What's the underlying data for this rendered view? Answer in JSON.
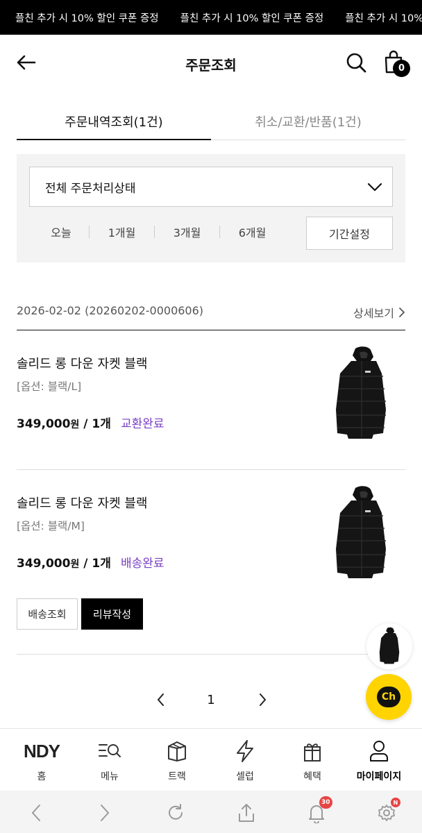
{
  "banner": {
    "messages": [
      "플친 추가 시 10% 할인 쿠폰 증정",
      "플친 추가 시 10% 할인 쿠폰 증정",
      "플친 추가 시 10% 할인 쿠폰 증정"
    ]
  },
  "header": {
    "title": "주문조회",
    "cart_count": "0"
  },
  "tabs": [
    {
      "label": "주문내역조회(1건)",
      "active": true
    },
    {
      "label": "취소/교환/반품(1건)",
      "active": false
    }
  ],
  "filter": {
    "status_select": "전체 주문처리상태",
    "periods": [
      "오늘",
      "1개월",
      "3개월",
      "6개월"
    ],
    "custom_period": "기간설정"
  },
  "order": {
    "date_number": "2026-02-02 (20260202-0000606)",
    "detail_label": "상세보기",
    "items": [
      {
        "name": "솔리드 롱 다운 자켓 블랙",
        "option": "[옵션: 블랙/L]",
        "price": "349,000",
        "currency": "원",
        "qty": " / 1개",
        "status": "교환완료"
      },
      {
        "name": "솔리드 롱 다운 자켓 블랙",
        "option": "[옵션: 블랙/M]",
        "price": "349,000",
        "currency": "원",
        "qty": " / 1개",
        "status": "배송완료"
      }
    ],
    "buttons": {
      "track": "배송조회",
      "review": "리뷰작성"
    }
  },
  "pagination": {
    "current": "1"
  },
  "chat": {
    "label": "Ch"
  },
  "bottom_nav": [
    {
      "label": "홈",
      "icon": "ndy-logo",
      "logo_text": "NDY"
    },
    {
      "label": "메뉴",
      "icon": "menu-search-icon"
    },
    {
      "label": "트랙",
      "icon": "box-icon"
    },
    {
      "label": "셀럽",
      "icon": "lightning-icon"
    },
    {
      "label": "혜택",
      "icon": "gift-icon"
    },
    {
      "label": "마이페이지",
      "icon": "person-icon",
      "active": true
    }
  ],
  "browser_bar": {
    "notification_count": "30",
    "settings_badge": "N"
  },
  "colors": {
    "status_purple": "#7a3fc6",
    "chat_yellow": "#ffd400",
    "badge_red": "#e64545"
  }
}
